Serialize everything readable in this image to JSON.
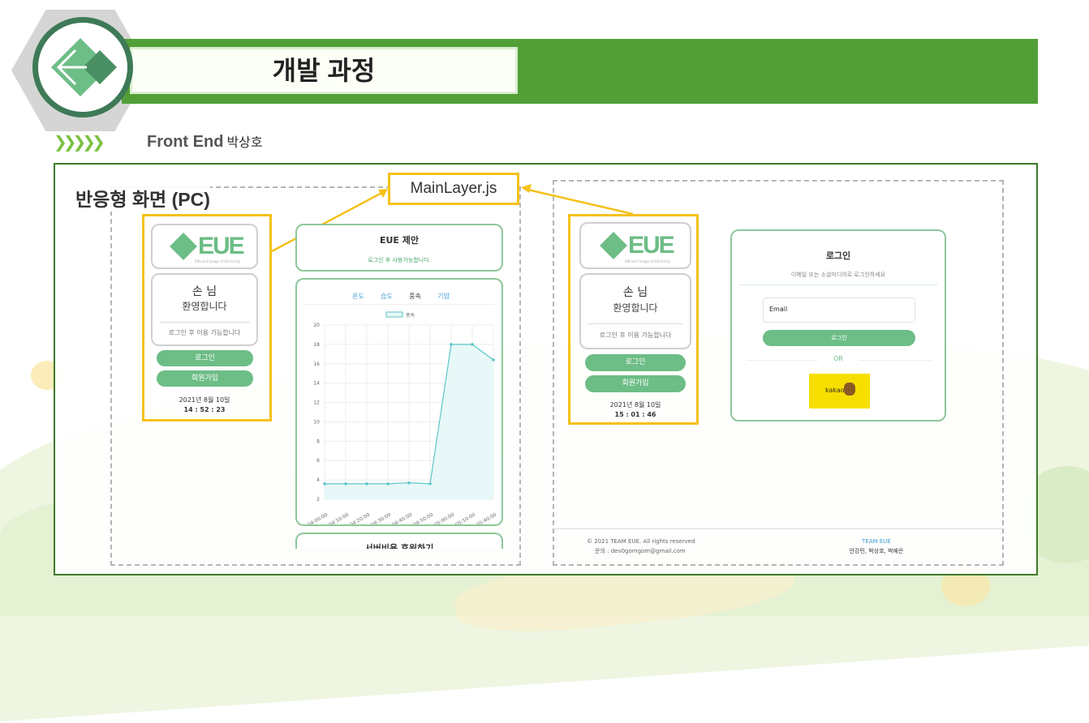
{
  "header": {
    "title": "개발 과정",
    "subtitle_prefix": "Front End",
    "subtitle_name": "박상호",
    "chevrons": "❯❯❯❯❯"
  },
  "section": {
    "label": "반응형 화면 (PC)",
    "file": "MainLayer.js"
  },
  "left_screen": {
    "logo_text": "EUE",
    "logo_sub": "Efficient Usage of Electricity",
    "greeting_name": "손 님",
    "greeting_welcome": "환영합니다",
    "login_hint": "로그인 후 이용 가능합니다",
    "login_button": "로그인",
    "signup_button": "회원가입",
    "date": "2021년 8월 10일",
    "time": "14 : 52 : 23",
    "suggestion_title": "EUE 제안",
    "suggestion_text": "로그인 후 사용가능합니다.",
    "chart_tabs": [
      "온도",
      "습도",
      "풍속",
      "기압"
    ],
    "chart_tab_active": 2,
    "bottom_card_title": "서버비용 후원하기"
  },
  "chart_data": {
    "type": "area",
    "series": [
      {
        "name": "풍속",
        "values": [
          3.6,
          3.6,
          3.6,
          3.6,
          3.7,
          3.6,
          18.0,
          18.0,
          16.4
        ]
      }
    ],
    "x": [
      "04:00:00",
      "04:10:00",
      "04:20:00",
      "04:30:00",
      "04:40:00",
      "04:50:00",
      "05:00:00",
      "05:10:00",
      "05:40:00"
    ],
    "y_ticks": [
      2,
      4,
      6,
      8,
      10,
      12,
      14,
      16,
      18,
      20
    ],
    "ylim": [
      2,
      20
    ],
    "grid": true,
    "legend": "top-center",
    "color": "#5cc6c9"
  },
  "right_screen": {
    "logo_text": "EUE",
    "logo_sub": "Efficient Usage of Electricity",
    "greeting_name": "손 님",
    "greeting_welcome": "환영합니다",
    "login_hint": "로그인 후 이용 가능합니다",
    "login_button": "로그인",
    "signup_button": "회원가입",
    "date": "2021년 8월 10일",
    "time": "15 : 01 : 46",
    "login_card": {
      "title": "로그인",
      "subtitle": "이메일 또는 소셜미디어로 로그인하세요",
      "email_value": "Email",
      "submit": "로그인",
      "or": "OR",
      "kakao": "kakao"
    },
    "footer": {
      "copyright": "© 2021 TEAM EUE. All rights reserved",
      "contact": "문의 : dev0gomgom@gmail.com",
      "team_title": "TEAM EUE",
      "team_members": "안강민, 박상호, 박예은"
    }
  },
  "colors": {
    "banner": "#529f37",
    "accent": "#6dbd86",
    "highlight": "#f5c11b",
    "frame": "#3d7a2a"
  }
}
